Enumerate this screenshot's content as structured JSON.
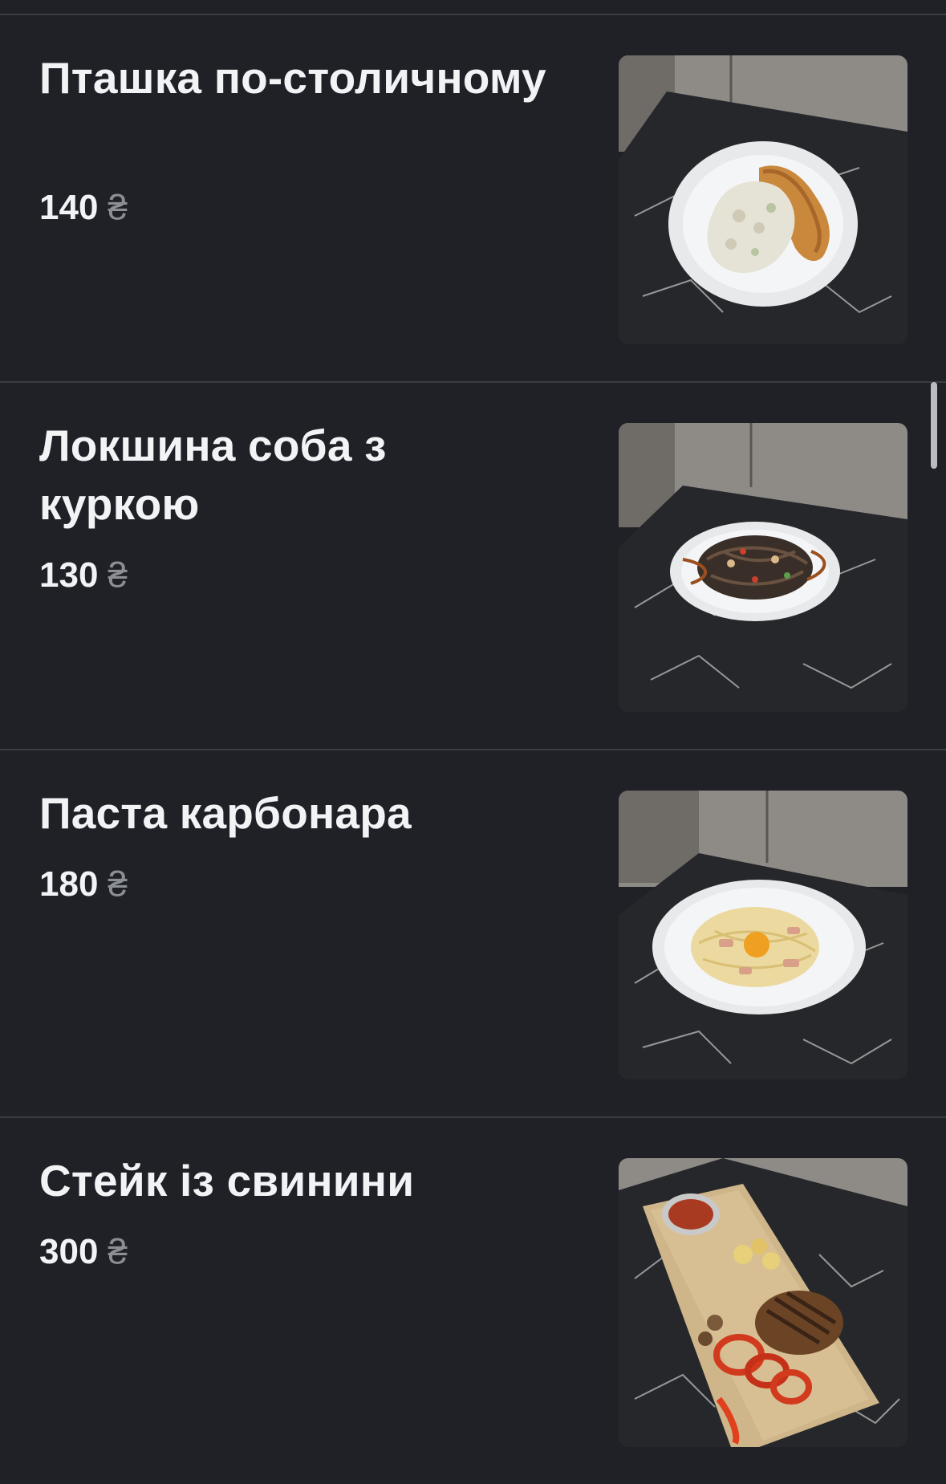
{
  "menu": {
    "items": [
      {
        "title": "Пташка по-столичному",
        "price": "140",
        "currency": "₴",
        "dish": "chicken schnitzel with creamy mushroom sauce"
      },
      {
        "title": "Локшина соба з куркою",
        "price": "130",
        "currency": "₴",
        "dish": "soba noodles with chicken"
      },
      {
        "title": "Паста карбонара",
        "price": "180",
        "currency": "₴",
        "dish": "pasta carbonara with egg yolk"
      },
      {
        "title": "Стейк із свинини",
        "price": "300",
        "currency": "₴",
        "dish": "grilled pork steak on wooden board"
      }
    ]
  },
  "colors": {
    "background": "#1f2127",
    "divider": "#3a3d44",
    "text": "#f2f3f5",
    "currency": "#8b8e95"
  }
}
